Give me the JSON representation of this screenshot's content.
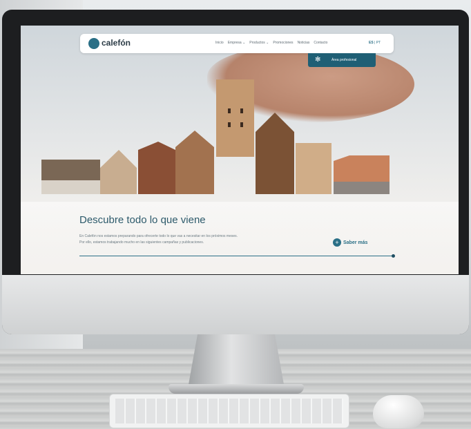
{
  "site": {
    "logo": "calefón",
    "nav": [
      "Inicio",
      "Empresa ⌄",
      "Productos ⌄",
      "Promociones",
      "Noticias",
      "Contacto"
    ],
    "lang": {
      "active": "ES",
      "separator": "|",
      "other": "PT"
    },
    "pro_area": "Área profesional"
  },
  "hero": {
    "title": "Descubre todo lo que viene",
    "text_line1": "En Calefón nos estamos preparando para ofrecerte todo lo que vas a necesitar en los próximos meses.",
    "text_line2": "Por ello, estamos trabajando mucho en las siguientes campañas y publicaciones.",
    "cta_label": "Saber más",
    "cta_icon": "+",
    "progress": 1.0
  },
  "colors": {
    "brand": "#2a6f86",
    "pro_button": "#1f5f75"
  },
  "icons": {
    "logo": "calefon-logo-icon",
    "pro": "snowflake-icon",
    "cta": "plus-icon"
  }
}
